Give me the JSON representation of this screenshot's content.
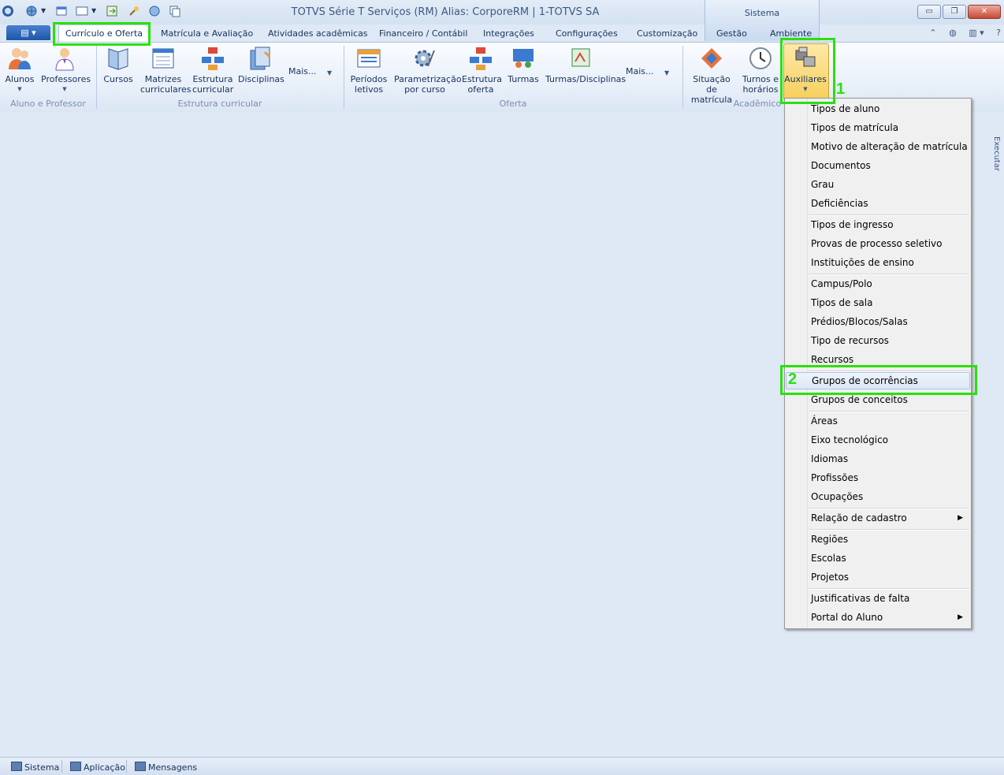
{
  "window": {
    "title": "TOTVS Série T Serviços (RM) Alias: CorporeRM | 1-TOTVS SA",
    "context_tab": "Sistema"
  },
  "tabs": {
    "items": [
      "Currículo e Oferta",
      "Matrícula e Avaliação",
      "Atividades acadêmicas",
      "Financeiro / Contábil",
      "Integrações",
      "Configurações",
      "Customização",
      "Gestão",
      "Ambiente"
    ],
    "active": "Currículo e Oferta"
  },
  "ribbon": {
    "buttons": {
      "alunos": "Alunos",
      "professores": "Professores",
      "cursos": "Cursos",
      "matrizes": "Matrizes\ncurriculares",
      "estrutura_curricular": "Estrutura\ncurricular",
      "disciplinas": "Disciplinas",
      "mais1": "Mais...",
      "periodos": "Períodos\nletivos",
      "parametrizacao": "Parametrização\npor curso",
      "estrutura_oferta": "Estrutura\noferta",
      "turmas": "Turmas",
      "turmas_disciplinas": "Turmas/Disciplinas",
      "mais2": "Mais...",
      "situacao": "Situação de\nmatrícula",
      "turnos": "Turnos e\nhorários",
      "auxiliares": "Auxiliares"
    },
    "groups": {
      "aluno_professor": "Aluno e Professor",
      "estrutura_curricular": "Estrutura curricular",
      "oferta": "Oferta",
      "academico": "Acadêmico"
    }
  },
  "annotations": {
    "step1": "1",
    "step2": "2"
  },
  "side_panel": {
    "executar": "Executar"
  },
  "menu": {
    "items": [
      {
        "label": "Tipos de aluno"
      },
      {
        "label": "Tipos de matrícula"
      },
      {
        "label": "Motivo de alteração de matrícula"
      },
      {
        "label": "Documentos"
      },
      {
        "label": "Grau"
      },
      {
        "label": "Deficiências"
      },
      {
        "label": "Tipos de ingresso"
      },
      {
        "label": "Provas de processo seletivo"
      },
      {
        "label": "Instituições de ensino"
      },
      {
        "label": "Campus/Polo"
      },
      {
        "label": "Tipos de sala"
      },
      {
        "label": "Prédios/Blocos/Salas"
      },
      {
        "label": "Tipo de recursos"
      },
      {
        "label": "Recursos"
      },
      {
        "label": "Grupos de ocorrências"
      },
      {
        "label": "Grupos de conceitos"
      },
      {
        "label": "Áreas"
      },
      {
        "label": "Eixo tecnológico"
      },
      {
        "label": "Idiomas"
      },
      {
        "label": "Profissões"
      },
      {
        "label": "Ocupações"
      },
      {
        "label": "Relação de cadastro"
      },
      {
        "label": "Regiões"
      },
      {
        "label": "Escolas"
      },
      {
        "label": "Projetos"
      },
      {
        "label": "Justificativas de falta"
      },
      {
        "label": "Portal do Aluno"
      }
    ]
  },
  "statusbar": {
    "sistema": "Sistema",
    "aplicacao": "Aplicação",
    "mensagens": "Mensagens"
  },
  "colors": {
    "highlight": "#2ae00e",
    "background": "#dfe9f5"
  }
}
